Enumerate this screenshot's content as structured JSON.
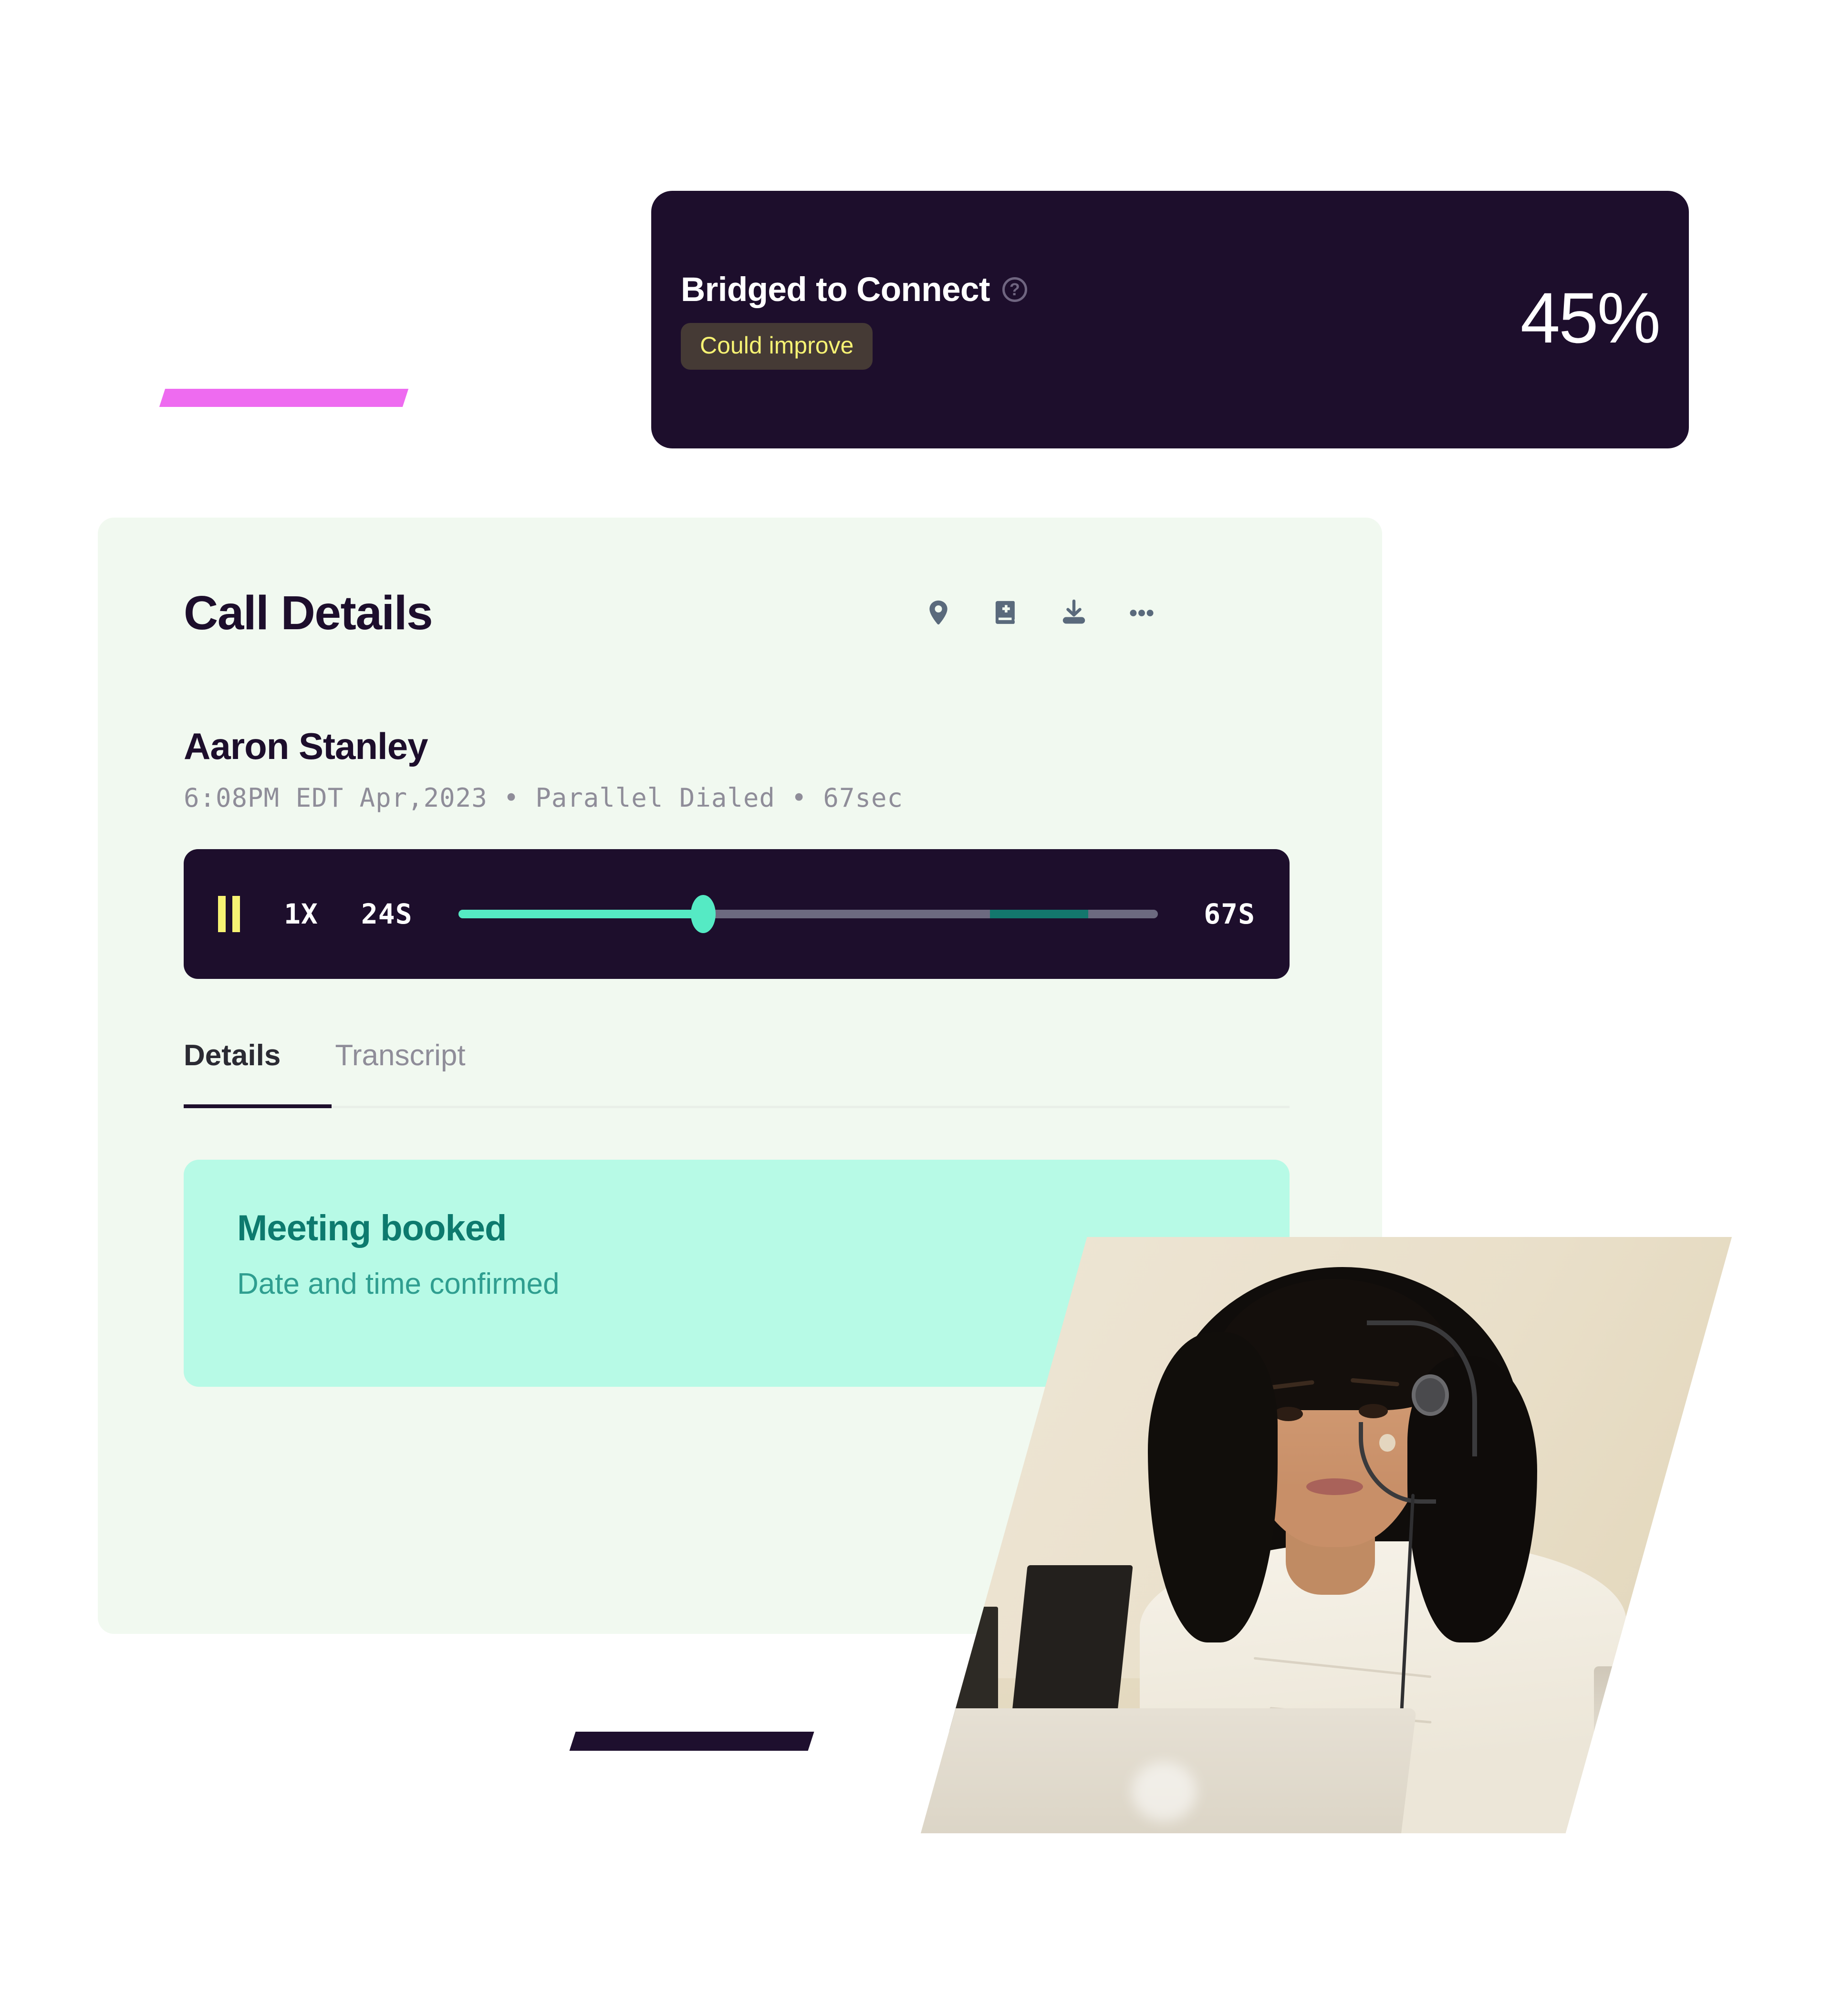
{
  "score_card": {
    "title": "Bridged to Connect",
    "help_icon": "question-mark-circle-icon",
    "badge": "Could improve",
    "value": "45%",
    "accent_dark": "#1d0e2c",
    "badge_bg": "#453a35",
    "badge_color": "#f6f273"
  },
  "call_card": {
    "title": "Call Details",
    "bg": "#f1f9f0",
    "actions": [
      {
        "name": "location-pin-icon",
        "label": "Location"
      },
      {
        "name": "book-plus-icon",
        "label": "Add to library"
      },
      {
        "name": "download-icon",
        "label": "Download"
      },
      {
        "name": "more-horizontal-icon",
        "label": "More options"
      }
    ],
    "contact": {
      "name": "Aaron Stanley",
      "meta": "6:08PM EDT Apr,2023 • Parallel Dialed • 67sec"
    },
    "player": {
      "state": "playing",
      "pause_icon": "pause-icon",
      "speed": "1X",
      "elapsed": "24S",
      "total": "67S",
      "progress_percent": 35,
      "segment_start_percent": 76,
      "segment_end_percent": 90,
      "fill_color": "#55eac4",
      "track_color": "#6c6a80",
      "segment_color": "#13776d",
      "bg": "#1d0e2c"
    },
    "tabs": [
      {
        "label": "Details",
        "active": true
      },
      {
        "label": "Transcript",
        "active": false
      }
    ],
    "meeting": {
      "title": "Meeting booked",
      "subtitle": "Date and time confirmed",
      "bg": "#b7fae6",
      "title_color": "#0d7a6e",
      "subtitle_color": "#2f9e90"
    }
  },
  "decor": {
    "magenta_bar_color": "#ee6bf0",
    "dark_bar_color": "#1d0e2c"
  },
  "photo": {
    "alt": "Call center agent wearing a headset working at a laptop"
  }
}
